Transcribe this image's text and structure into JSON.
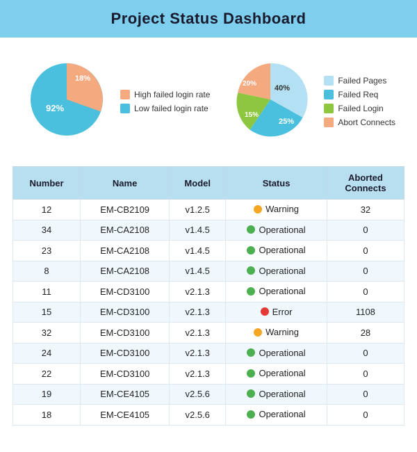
{
  "header": {
    "title": "Project Status Dashboard"
  },
  "charts": {
    "left": {
      "slices": [
        {
          "label": "High failed login rate",
          "color": "#f5a97f",
          "percent": 18,
          "angle_start": 0,
          "angle_end": 64.8
        },
        {
          "label": "Low failed login rate",
          "color": "#4bbfde",
          "percent": 92,
          "angle_start": 64.8,
          "angle_end": 360
        }
      ],
      "legend": [
        {
          "label": "High failed login rate",
          "color": "#f5a97f"
        },
        {
          "label": "Low failed login rate",
          "color": "#4bbfde"
        }
      ]
    },
    "right": {
      "slices": [
        {
          "label": "Failed Pages",
          "color": "#b3e0f2",
          "percent": 40
        },
        {
          "label": "Failed Req",
          "color": "#4bbfde",
          "percent": 25
        },
        {
          "label": "Failed Login",
          "color": "#8dc63f",
          "percent": 15
        },
        {
          "label": "Abort Connects",
          "color": "#f5a97f",
          "percent": 20
        }
      ],
      "legend": [
        {
          "label": "Failed Pages",
          "color": "#b3e0f2"
        },
        {
          "label": "Failed Req",
          "color": "#4bbfde"
        },
        {
          "label": "Failed Login",
          "color": "#8dc63f"
        },
        {
          "label": "Abort Connects",
          "color": "#f5a97f"
        }
      ]
    }
  },
  "table": {
    "headers": [
      "Number",
      "Name",
      "Model",
      "Status",
      "Aborted Connects"
    ],
    "rows": [
      {
        "number": 12,
        "name": "EM-CB2109",
        "model": "v1.2.5",
        "status": "Warning",
        "status_type": "warning",
        "aborted": 32
      },
      {
        "number": 34,
        "name": "EM-CA2108",
        "model": "v1.4.5",
        "status": "Operational",
        "status_type": "operational",
        "aborted": 0
      },
      {
        "number": 23,
        "name": "EM-CA2108",
        "model": "v1.4.5",
        "status": "Operational",
        "status_type": "operational",
        "aborted": 0
      },
      {
        "number": 8,
        "name": "EM-CA2108",
        "model": "v1.4.5",
        "status": "Operational",
        "status_type": "operational",
        "aborted": 0
      },
      {
        "number": 11,
        "name": "EM-CD3100",
        "model": "v2.1.3",
        "status": "Operational",
        "status_type": "operational",
        "aborted": 0
      },
      {
        "number": 15,
        "name": "EM-CD3100",
        "model": "v2.1.3",
        "status": "Error",
        "status_type": "error",
        "aborted": 1108
      },
      {
        "number": 32,
        "name": "EM-CD3100",
        "model": "v2.1.3",
        "status": "Warning",
        "status_type": "warning",
        "aborted": 28
      },
      {
        "number": 24,
        "name": "EM-CD3100",
        "model": "v2.1.3",
        "status": "Operational",
        "status_type": "operational",
        "aborted": 0
      },
      {
        "number": 22,
        "name": "EM-CD3100",
        "model": "v2.1.3",
        "status": "Operational",
        "status_type": "operational",
        "aborted": 0
      },
      {
        "number": 19,
        "name": "EM-CE4105",
        "model": "v2.5.6",
        "status": "Operational",
        "status_type": "operational",
        "aborted": 0
      },
      {
        "number": 18,
        "name": "EM-CE4105",
        "model": "v2.5.6",
        "status": "Operational",
        "status_type": "operational",
        "aborted": 0
      }
    ]
  }
}
